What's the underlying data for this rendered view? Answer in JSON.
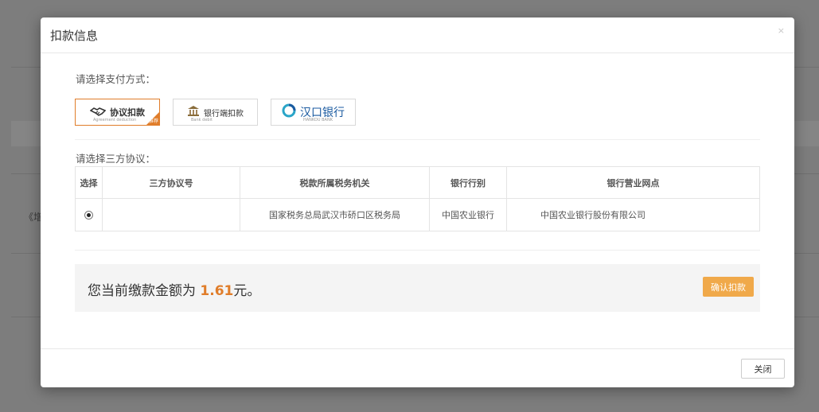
{
  "background": {
    "partial_text": "《增"
  },
  "modal": {
    "title": "扣款信息",
    "close_x": "×",
    "pay_section_label": "请选择支付方式：",
    "pay_methods": [
      {
        "label": "协议扣款",
        "sub": "Agreement deduction",
        "badge": "推荐",
        "selected": true,
        "icon": "handshake-icon"
      },
      {
        "label": "银行端扣款",
        "sub": "Bank debit",
        "selected": false,
        "icon": "bank-building-icon"
      },
      {
        "label": "汉口银行",
        "sub": "HANKOU BANK",
        "selected": false,
        "icon": "hankou-bank-logo"
      }
    ],
    "agreement_section_label": "请选择三方协议：",
    "table": {
      "headers": [
        "选择",
        "三方协议号",
        "税款所属税务机关",
        "银行行别",
        "银行营业网点"
      ],
      "rows": [
        {
          "selected": true,
          "agreement_no": "",
          "tax_authority": "国家税务总局武汉市硚口区税务局",
          "bank": "中国农业银行",
          "branch": "中国农业银行股份有限公司"
        }
      ]
    },
    "amount_prefix": "您当前缴款金额为",
    "amount_value": "1.61",
    "amount_suffix": "元。",
    "confirm_label": "确认扣款",
    "close_label": "关闭",
    "colors": {
      "accent": "#e07d2a",
      "confirm_bg": "#f0a94a",
      "hankou_blue": "#1a5aa0"
    }
  }
}
